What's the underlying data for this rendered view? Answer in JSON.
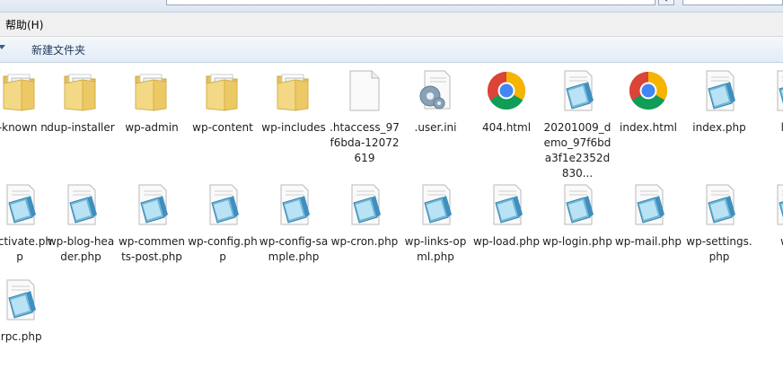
{
  "menu": {
    "help": "帮助(H)"
  },
  "toolbar": {
    "new_folder": "新建文件夹"
  },
  "files": [
    {
      "name": "ll-known\nn",
      "type": "folder"
    },
    {
      "name": "dup-installer",
      "type": "folder"
    },
    {
      "name": "wp-admin",
      "type": "folder"
    },
    {
      "name": "wp-content",
      "type": "folder"
    },
    {
      "name": "wp-includes",
      "type": "folder"
    },
    {
      "name": ".htaccess_97f6bda-12072619",
      "type": "blank"
    },
    {
      "name": ".user.ini",
      "type": "config"
    },
    {
      "name": "404.html",
      "type": "chrome"
    },
    {
      "name": "20201009_demo_97f6bda3f1e2352d830...",
      "type": "php"
    },
    {
      "name": "index.html",
      "type": "chrome"
    },
    {
      "name": "index.php",
      "type": "php"
    },
    {
      "name": "lice",
      "type": "php"
    },
    {
      "name": "-activate.php",
      "type": "php"
    },
    {
      "name": "wp-blog-header.php",
      "type": "php"
    },
    {
      "name": "wp-comments-post.php",
      "type": "php"
    },
    {
      "name": "wp-config.php",
      "type": "php"
    },
    {
      "name": "wp-config-sample.php",
      "type": "php"
    },
    {
      "name": "wp-cron.php",
      "type": "php"
    },
    {
      "name": "wp-links-opml.php",
      "type": "php"
    },
    {
      "name": "wp-load.php",
      "type": "php"
    },
    {
      "name": "wp-login.php",
      "type": "php"
    },
    {
      "name": "wp-mail.php",
      "type": "php"
    },
    {
      "name": "wp-settings.php",
      "type": "php"
    },
    {
      "name": "wp-",
      "type": "php"
    },
    {
      "name": "lrpc.php",
      "type": "php"
    }
  ]
}
